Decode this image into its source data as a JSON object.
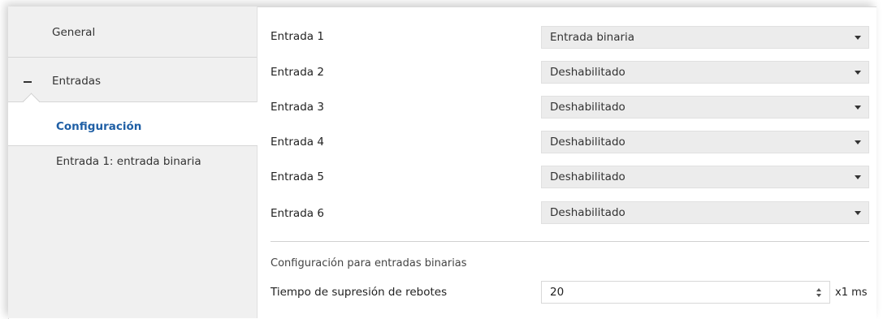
{
  "sidebar": {
    "items": [
      {
        "label": "General"
      },
      {
        "label": "Entradas"
      },
      {
        "label": "Configuración"
      },
      {
        "label": "Entrada 1: entrada binaria"
      }
    ]
  },
  "main": {
    "inputs": [
      {
        "label": "Entrada 1",
        "value": "Entrada binaria"
      },
      {
        "label": "Entrada 2",
        "value": "Deshabilitado"
      },
      {
        "label": "Entrada 3",
        "value": "Deshabilitado"
      },
      {
        "label": "Entrada 4",
        "value": "Deshabilitado"
      },
      {
        "label": "Entrada 5",
        "value": "Deshabilitado"
      },
      {
        "label": "Entrada 6",
        "value": "Deshabilitado"
      }
    ],
    "section_title": "Configuración para entradas binarias",
    "debounce": {
      "label": "Tiempo de supresión de rebotes",
      "value": "20",
      "unit": "x1 ms"
    }
  },
  "colors": {
    "accent": "#1f5fa5",
    "sidebar_bg": "#f0f0f0",
    "select_bg": "#ececec"
  }
}
